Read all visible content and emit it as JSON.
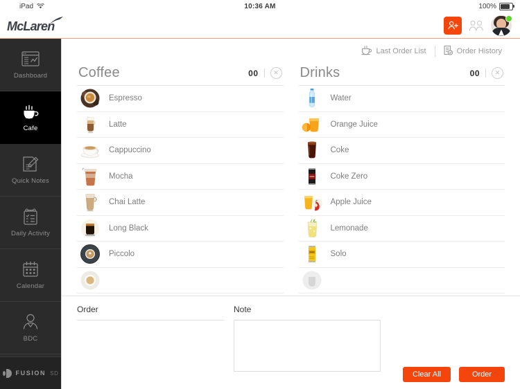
{
  "statusbar": {
    "device": "iPad",
    "wifi_icon": "wifi-icon",
    "time": "10:36 AM",
    "battery_percent": "100%",
    "battery_icon": "battery-full-icon"
  },
  "header": {
    "brand": "McLaren",
    "add_user_icon": "add-user-icon",
    "users_icon": "users-icon",
    "avatar_icon": "user-avatar",
    "status_dot": "online-dot",
    "accent_color": "#f4450c",
    "rule_color": "#f0a083"
  },
  "sidebar": {
    "items": [
      {
        "label": "Dashboard",
        "icon": "dashboard-icon",
        "active": false
      },
      {
        "label": "Cafe",
        "icon": "coffee-cup-icon",
        "active": true
      },
      {
        "label": "Quick Notes",
        "icon": "note-pencil-icon",
        "active": false
      },
      {
        "label": "Daily Activity",
        "icon": "clipboard-checklist-icon",
        "active": false
      },
      {
        "label": "Calendar",
        "icon": "calendar-icon",
        "active": false
      },
      {
        "label": "BDC",
        "icon": "person-tie-icon",
        "active": false
      }
    ],
    "footer": {
      "logo_icon": "fusion-logo-icon",
      "name": "FUSION",
      "suffix": "SD"
    }
  },
  "toolbar": {
    "last_order_list": {
      "label": "Last Order List",
      "icon": "coffee-cup-icon"
    },
    "order_history": {
      "label": "Order History",
      "icon": "order-history-icon"
    }
  },
  "columns": [
    {
      "title": "Coffee",
      "count": "00",
      "clear_icon": "clear-circle-x-icon",
      "items": [
        {
          "label": "Espresso",
          "icon": "espresso-cup-icon"
        },
        {
          "label": "Latte",
          "icon": "latte-glass-icon"
        },
        {
          "label": "Cappuccino",
          "icon": "cappuccino-cup-icon"
        },
        {
          "label": "Mocha",
          "icon": "mocha-takeaway-cup-icon"
        },
        {
          "label": "Chai Latte",
          "icon": "chai-latte-glass-icon"
        },
        {
          "label": "Long Black",
          "icon": "long-black-glass-icon"
        },
        {
          "label": "Piccolo",
          "icon": "piccolo-cup-icon"
        },
        {
          "label": "",
          "icon": "coffee-cup-icon"
        }
      ]
    },
    {
      "title": "Drinks",
      "count": "00",
      "clear_icon": "clear-circle-x-icon",
      "items": [
        {
          "label": "Water",
          "icon": "water-bottle-icon"
        },
        {
          "label": "Orange Juice",
          "icon": "orange-juice-icon"
        },
        {
          "label": "Coke",
          "icon": "coke-glass-icon"
        },
        {
          "label": "Coke Zero",
          "icon": "coke-zero-can-icon"
        },
        {
          "label": "Apple Juice",
          "icon": "apple-juice-icon"
        },
        {
          "label": "Lemonade",
          "icon": "lemonade-glass-icon"
        },
        {
          "label": "Solo",
          "icon": "solo-can-icon"
        },
        {
          "label": "",
          "icon": "drink-icon"
        }
      ]
    }
  ],
  "bottom": {
    "order_label": "Order",
    "order_value": "",
    "note_label": "Note",
    "note_value": "",
    "note_placeholder": "",
    "clear_all_label": "Clear All",
    "order_button_label": "Order"
  }
}
